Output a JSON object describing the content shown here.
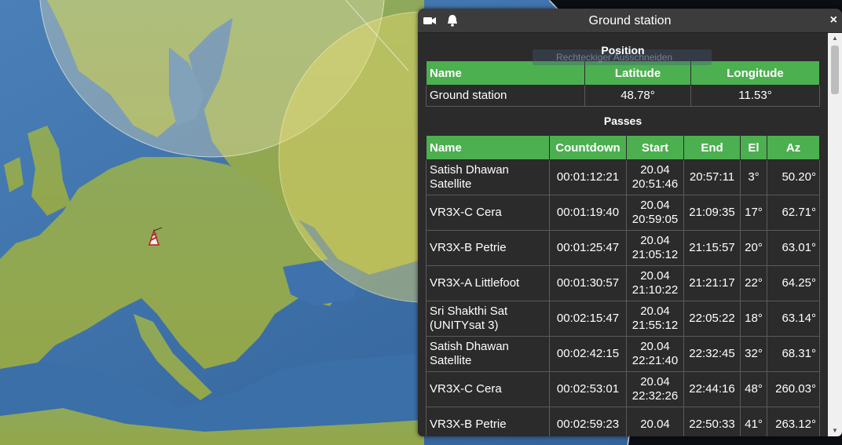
{
  "window": {
    "title": "Ground station",
    "close_label": "×",
    "icons": [
      "camera-icon",
      "bell-icon"
    ]
  },
  "ghost_tooltip": "Rechteckiger Ausschneiden",
  "position": {
    "heading": "Position",
    "columns": [
      "Name",
      "Latitude",
      "Longitude"
    ],
    "row": {
      "name": "Ground station",
      "latitude": "48.78°",
      "longitude": "11.53°"
    }
  },
  "passes": {
    "heading": "Passes",
    "columns": [
      "Name",
      "Countdown",
      "Start",
      "End",
      "El",
      "Az"
    ],
    "rows": [
      {
        "name": "Satish Dhawan Satellite",
        "countdown": "00:01:12:21",
        "start": "20.04 20:51:46",
        "end": "20:57:11",
        "el": "3°",
        "az": "50.20°"
      },
      {
        "name": "VR3X-C Cera",
        "countdown": "00:01:19:40",
        "start": "20.04 20:59:05",
        "end": "21:09:35",
        "el": "17°",
        "az": "62.71°"
      },
      {
        "name": "VR3X-B Petrie",
        "countdown": "00:01:25:47",
        "start": "20.04 21:05:12",
        "end": "21:15:57",
        "el": "20°",
        "az": "63.01°"
      },
      {
        "name": "VR3X-A Littlefoot",
        "countdown": "00:01:30:57",
        "start": "20.04 21:10:22",
        "end": "21:21:17",
        "el": "22°",
        "az": "64.25°"
      },
      {
        "name": "Sri Shakthi Sat (UNITYsat 3)",
        "countdown": "00:02:15:47",
        "start": "20.04 21:55:12",
        "end": "22:05:22",
        "el": "18°",
        "az": "63.14°"
      },
      {
        "name": "Satish Dhawan Satellite",
        "countdown": "00:02:42:15",
        "start": "20.04 22:21:40",
        "end": "22:32:45",
        "el": "32°",
        "az": "68.31°"
      },
      {
        "name": "VR3X-C Cera",
        "countdown": "00:02:53:01",
        "start": "20.04 22:32:26",
        "end": "22:44:16",
        "el": "48°",
        "az": "260.03°"
      },
      {
        "name": "VR3X-B Petrie",
        "countdown": "00:02:59:23",
        "start": "20.04",
        "end": "22:50:33",
        "el": "41°",
        "az": "263.12°"
      }
    ]
  },
  "colors": {
    "header_green": "#4caf50",
    "panel_bg": "#2b2b2b",
    "ocean": "#3a6fa8",
    "land": "#8fae4f",
    "coverage": "#e8e07a"
  }
}
